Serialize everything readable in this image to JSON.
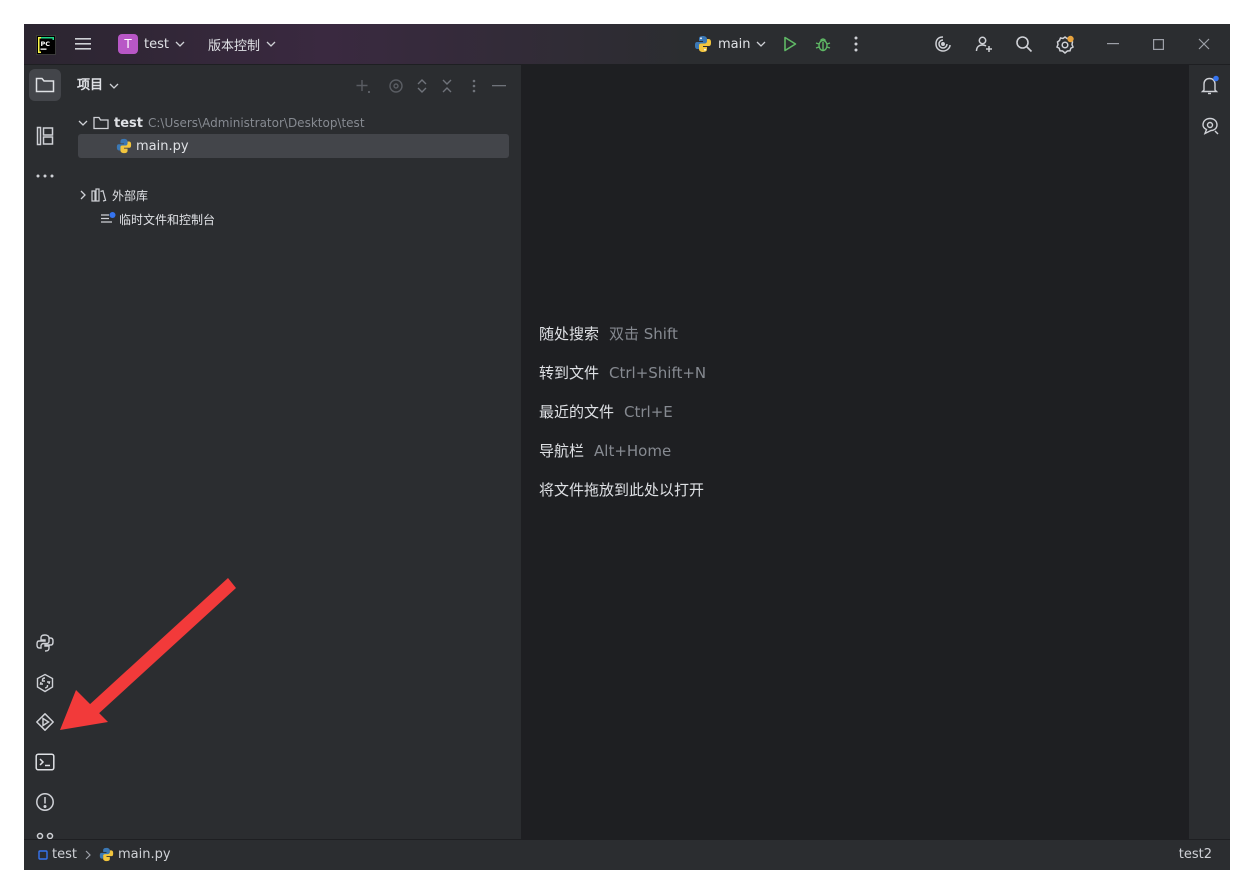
{
  "titlebar": {
    "project_badge": "T",
    "project_name": "test",
    "vcs_label": "版本控制",
    "run_config": "main"
  },
  "project_panel": {
    "title": "项目",
    "tree": {
      "root_name": "test",
      "root_path": "C:\\Users\\Administrator\\Desktop\\test",
      "file": "main.py",
      "external_libs": "外部库",
      "scratches": "临时文件和控制台"
    }
  },
  "editor": {
    "hints": [
      {
        "label": "随处搜索",
        "shortcut": "双击 Shift"
      },
      {
        "label": "转到文件",
        "shortcut": "Ctrl+Shift+N"
      },
      {
        "label": "最近的文件",
        "shortcut": "Ctrl+E"
      },
      {
        "label": "导航栏",
        "shortcut": "Alt+Home"
      },
      {
        "label": "将文件拖放到此处以打开",
        "shortcut": ""
      }
    ]
  },
  "statusbar": {
    "crumb_project": "test",
    "crumb_file": "main.py",
    "interpreter": "test2"
  },
  "icons": {
    "app_logo": "pycharm-logo",
    "annotation": "red-arrow-pointing-to-terminal"
  },
  "colors": {
    "accent_badge": "#b857c6",
    "run_green": "#5fb865",
    "bg_dark": "#1e1f22",
    "panel": "#2b2d30",
    "arrow_red": "#f23a3a"
  }
}
